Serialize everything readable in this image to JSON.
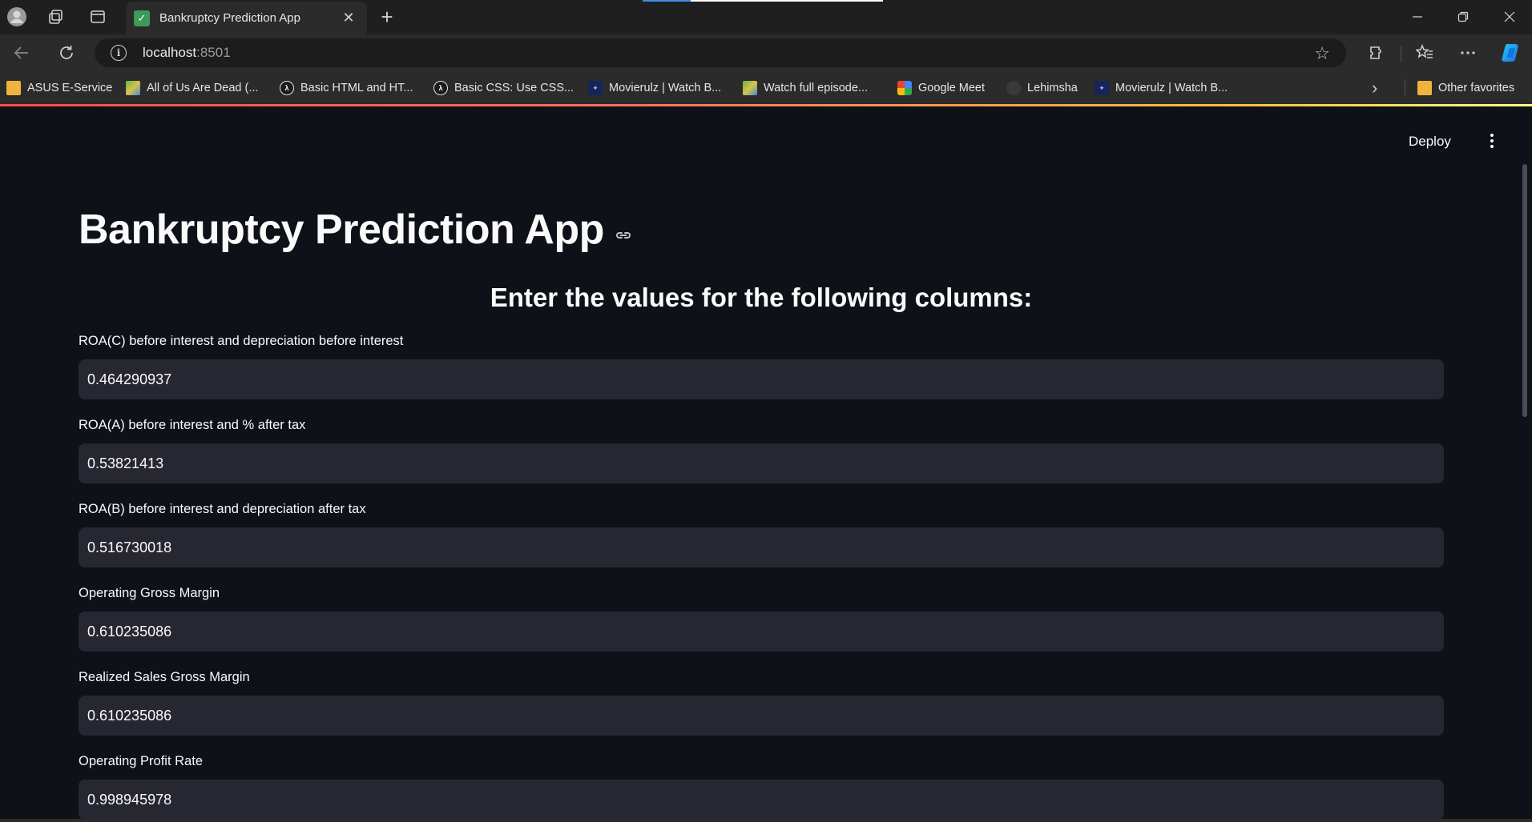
{
  "browser": {
    "tab_title": "Bankruptcy Prediction App",
    "url_host": "localhost",
    "url_port": ":8501",
    "bookmarks": [
      {
        "label": "ASUS E-Service",
        "icon": "folder-icon"
      },
      {
        "label": "All of Us Are Dead (...",
        "icon": "image-favicon"
      },
      {
        "label": "Basic HTML and HT...",
        "icon": "freecodecamp-icon"
      },
      {
        "label": "Basic CSS: Use CSS...",
        "icon": "freecodecamp-icon"
      },
      {
        "label": "Movierulz | Watch B...",
        "icon": "movierulz-icon"
      },
      {
        "label": "Watch full episode...",
        "icon": "image-favicon"
      },
      {
        "label": "Google Meet",
        "icon": "google-meet-icon"
      },
      {
        "label": "Lehimsha",
        "icon": "github-icon"
      },
      {
        "label": "Movierulz | Watch B...",
        "icon": "movierulz-icon"
      }
    ],
    "other_favorites": "Other favorites"
  },
  "app": {
    "deploy_label": "Deploy",
    "title": "Bankruptcy Prediction App",
    "subheader": "Enter the values for the following columns:",
    "fields": [
      {
        "label": "ROA(C) before interest and depreciation before interest",
        "value": "0.464290937"
      },
      {
        "label": "ROA(A) before interest and % after tax",
        "value": "0.53821413"
      },
      {
        "label": "ROA(B) before interest and depreciation after tax",
        "value": "0.516730018"
      },
      {
        "label": "Operating Gross Margin",
        "value": "0.610235086"
      },
      {
        "label": "Realized Sales Gross Margin",
        "value": "0.610235086"
      },
      {
        "label": "Operating Profit Rate",
        "value": "0.998945978"
      }
    ]
  },
  "colors": {
    "app_bg": "#0e1117",
    "input_bg": "#262730",
    "header_gradient_start": "#ff4b4b",
    "header_gradient_end": "#fffd80"
  }
}
